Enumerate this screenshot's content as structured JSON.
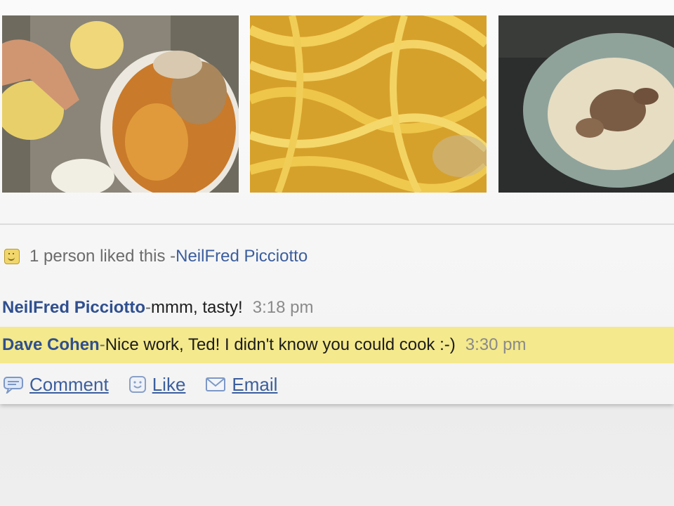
{
  "photos": [
    {
      "icon": "dough-and-mushrooms-photo"
    },
    {
      "icon": "fresh-pasta-photo"
    },
    {
      "icon": "pasta-dish-photo"
    }
  ],
  "likes": {
    "text": "1 person liked this - ",
    "liker": "NeilFred Picciotto"
  },
  "comments": [
    {
      "author": "NeilFred Picciotto",
      "sep": " - ",
      "text": "mmm, tasty!",
      "time": "3:18 pm"
    },
    {
      "author": "Dave Cohen",
      "sep": " - ",
      "text": "Nice work, Ted! I didn't know you could cook :-)",
      "time": "3:30 pm",
      "highlight": "#f4e98c"
    }
  ],
  "actions": {
    "comment": "Comment",
    "like": "Like",
    "email": "Email"
  },
  "colors": {
    "link": "#3b5e9e",
    "highlight": "#f4e98c"
  }
}
